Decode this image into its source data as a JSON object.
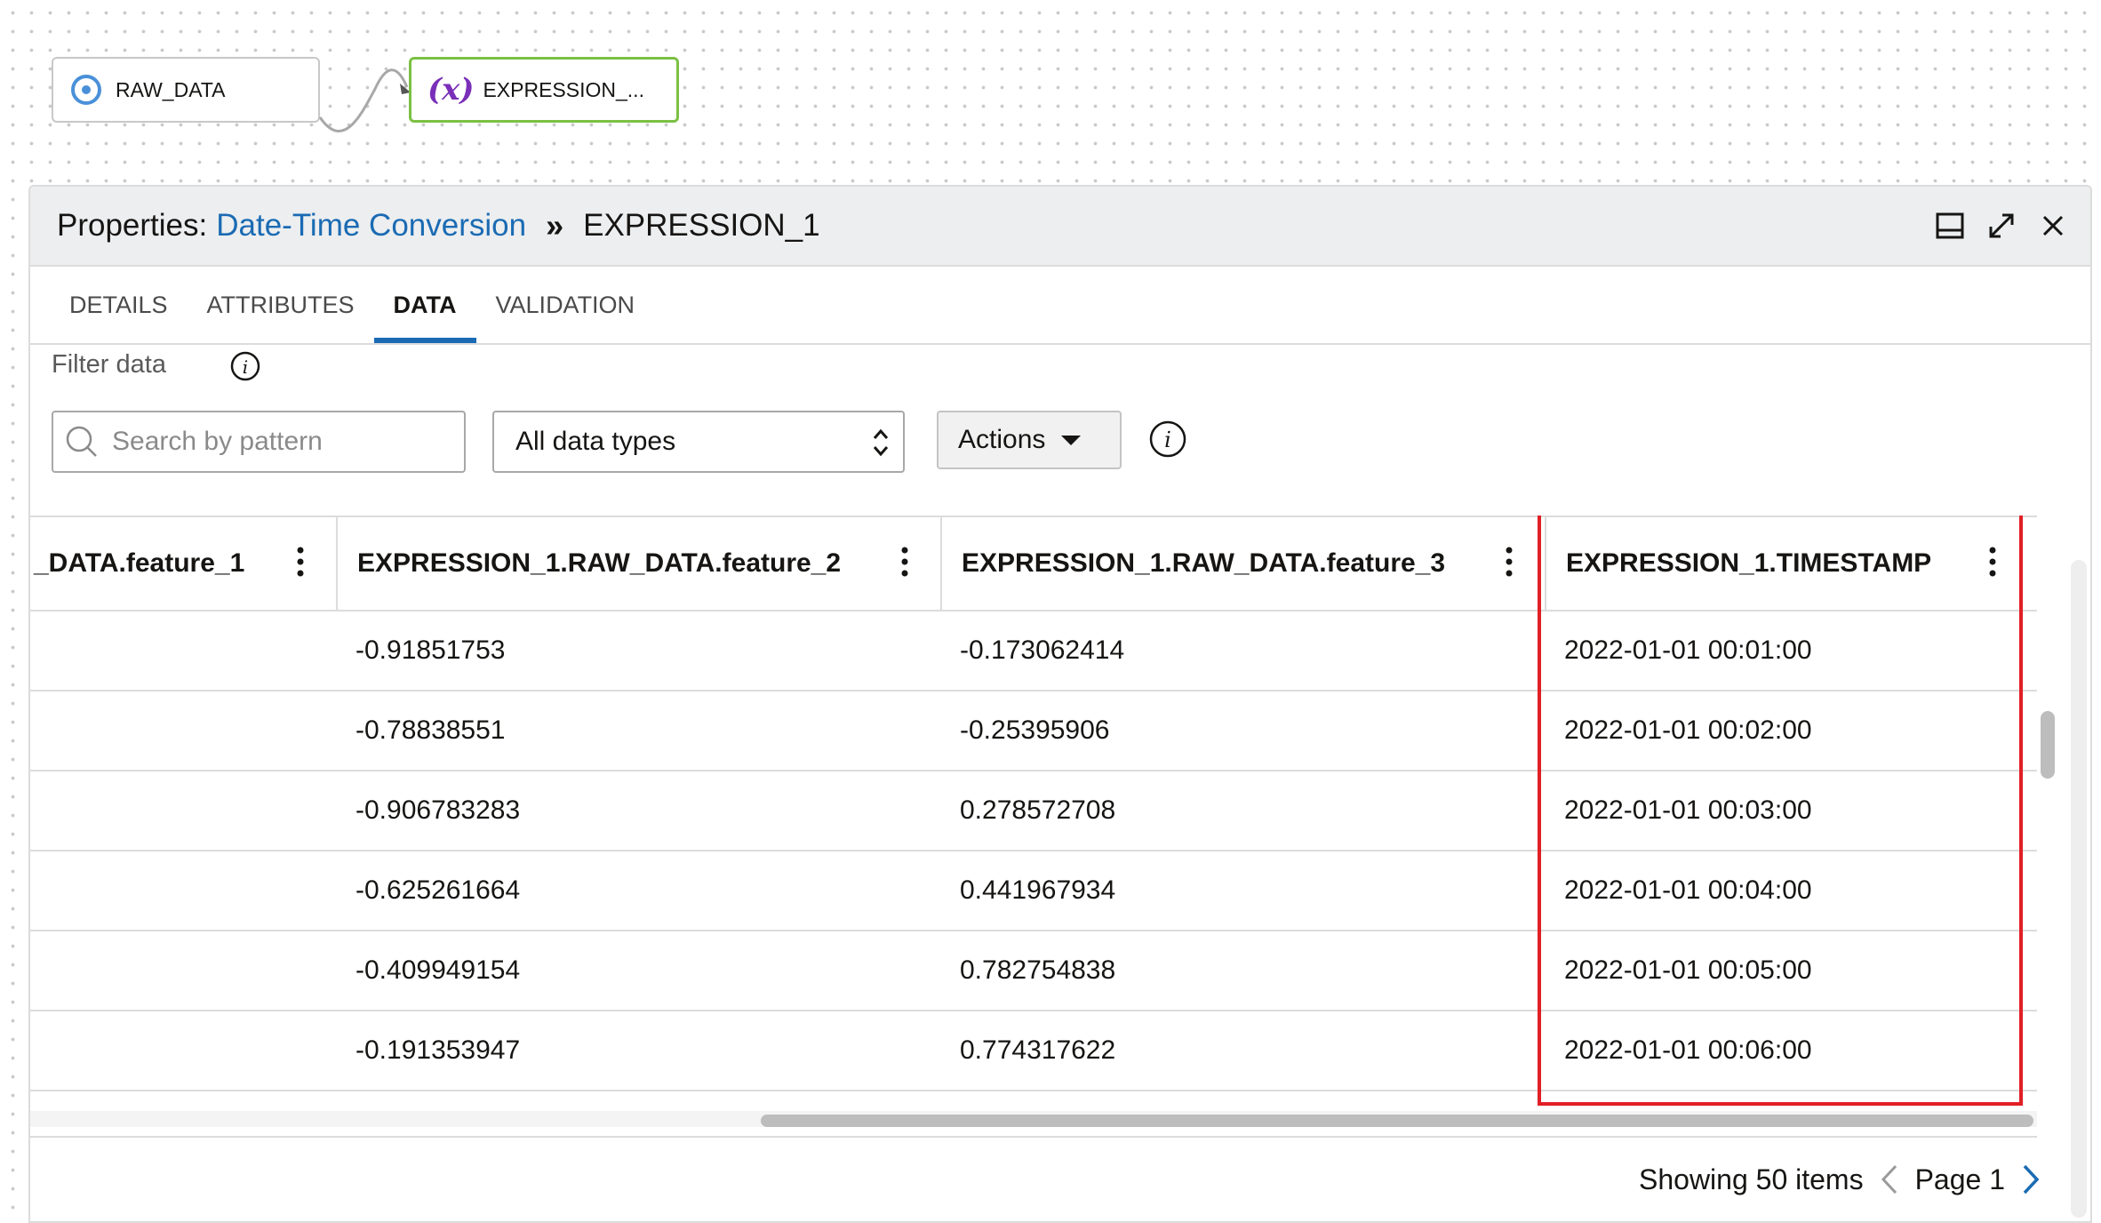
{
  "flow": {
    "nodes": [
      {
        "label": "RAW_DATA",
        "icon": "source-icon"
      },
      {
        "label": "EXPRESSION_...",
        "icon": "expression-icon",
        "icon_text": "(x)"
      }
    ]
  },
  "panel": {
    "title_prefix": "Properties:",
    "title_link": "Date-Time Conversion",
    "separator": "»",
    "title_node": "EXPRESSION_1",
    "icons": [
      "dock-icon",
      "expand-icon",
      "close-icon"
    ]
  },
  "tabs": [
    {
      "label": "DETAILS",
      "active": false
    },
    {
      "label": "ATTRIBUTES",
      "active": false
    },
    {
      "label": "DATA",
      "active": true
    },
    {
      "label": "VALIDATION",
      "active": false
    }
  ],
  "filter": {
    "label": "Filter data",
    "search_placeholder": "Search by pattern",
    "data_type_selected": "All data types",
    "actions_label": "Actions"
  },
  "grid": {
    "columns": [
      "_DATA.feature_1",
      "EXPRESSION_1.RAW_DATA.feature_2",
      "EXPRESSION_1.RAW_DATA.feature_3",
      "EXPRESSION_1.TIMESTAMP"
    ],
    "rows": [
      [
        "",
        "-0.91851753",
        "-0.173062414",
        "2022-01-01 00:01:00"
      ],
      [
        "",
        "-0.78838551",
        "-0.25395906",
        "2022-01-01 00:02:00"
      ],
      [
        "",
        "-0.906783283",
        "0.278572708",
        "2022-01-01 00:03:00"
      ],
      [
        "",
        "-0.625261664",
        "0.441967934",
        "2022-01-01 00:04:00"
      ],
      [
        "",
        "-0.409949154",
        "0.782754838",
        "2022-01-01 00:05:00"
      ],
      [
        "",
        "-0.191353947",
        "0.774317622",
        "2022-01-01 00:06:00"
      ]
    ],
    "highlight_color": "#e11f26"
  },
  "footer": {
    "showing": "Showing 50 items",
    "page": "Page 1"
  },
  "colors": {
    "accent": "#1a6bb3",
    "node_border_active": "#7bc043",
    "expression_icon": "#7a2fb8"
  }
}
